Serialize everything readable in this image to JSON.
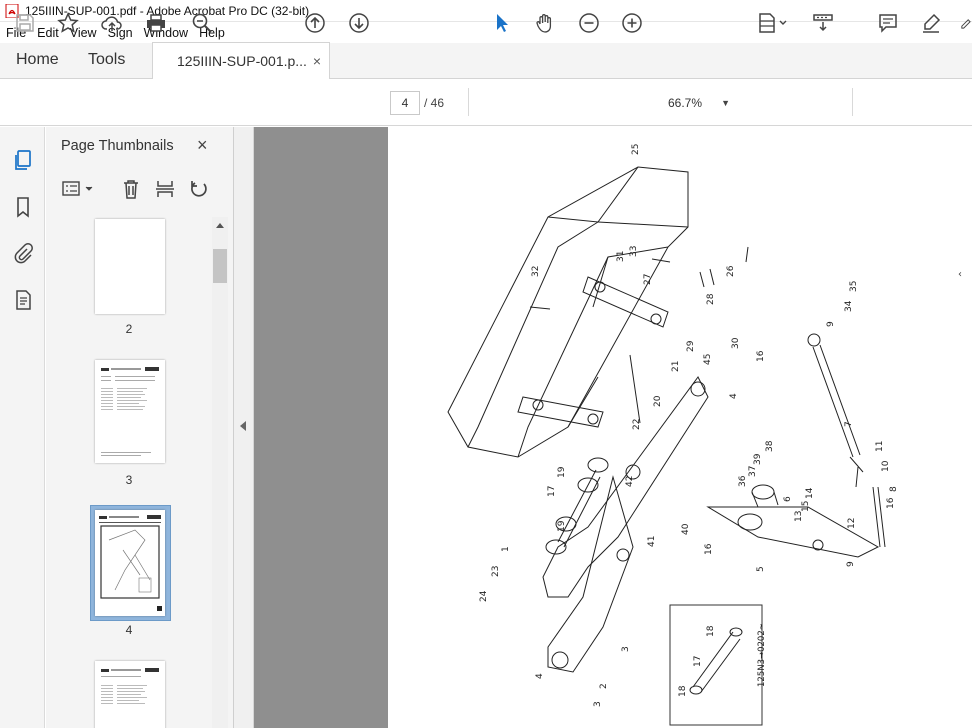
{
  "window": {
    "title": "125IIIN-SUP-001.pdf - Adobe Acrobat Pro DC (32-bit)"
  },
  "menu": [
    "File",
    "Edit",
    "View",
    "Sign",
    "Window",
    "Help"
  ],
  "tabs": {
    "home": "Home",
    "tools": "Tools",
    "document": "125IIIN-SUP-001.p...",
    "close": "×"
  },
  "toolbar": {
    "page_current": "4",
    "page_total": "/ 46",
    "zoom": "66.7%"
  },
  "panel": {
    "title": "Page Thumbnails",
    "close": "×"
  },
  "thumbnails": [
    {
      "label": "2"
    },
    {
      "label": "3"
    },
    {
      "label": "4",
      "selected": true
    },
    {
      "label": ""
    }
  ],
  "drawing": {
    "part_numbers": [
      "25",
      "26",
      "27",
      "28",
      "29",
      "30",
      "31",
      "32",
      "33",
      "34",
      "35",
      "9",
      "16",
      "45",
      "21",
      "4",
      "20",
      "22",
      "7",
      "11",
      "10",
      "8",
      "38",
      "39",
      "37",
      "36",
      "6",
      "14",
      "15",
      "13",
      "12",
      "16",
      "9",
      "5",
      "42",
      "40",
      "41",
      "16",
      "19",
      "17",
      "19",
      "1",
      "23",
      "24",
      "3",
      "2",
      "4",
      "3"
    ],
    "inset_labels": [
      "18",
      "17",
      "18"
    ],
    "inset_code": "125N3→0202~"
  },
  "colors": {
    "accent": "#1a73c8",
    "panel_bg": "#f4f4f4",
    "viewer_bg": "#8f8f8f",
    "selected_thumb": "#8fb5dc"
  }
}
